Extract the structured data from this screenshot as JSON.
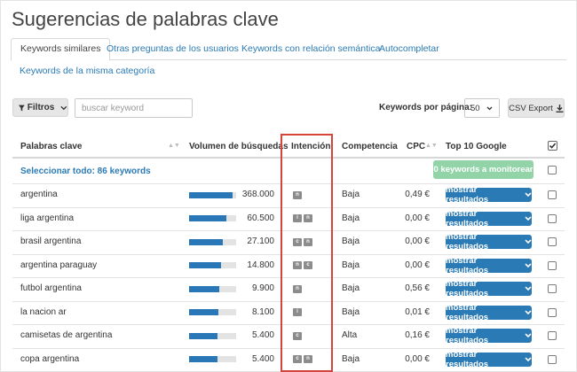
{
  "page": {
    "title": "Sugerencias de palabras clave"
  },
  "tabs": [
    {
      "label": "Keywords similares",
      "active": true
    },
    {
      "label": "Otras preguntas de los usuarios"
    },
    {
      "label": "Keywords con relación semántica"
    },
    {
      "label": "Autocompletar"
    },
    {
      "label": "Keywords de la misma categoría"
    }
  ],
  "toolbar": {
    "filter_label": "Filtros",
    "search_placeholder": "buscar keyword",
    "per_page_label": "Keywords por página:",
    "per_page_value": "50",
    "csv_label": "CSV Export"
  },
  "table": {
    "headers": {
      "keyword": "Palabras clave",
      "volume": "Volumen de búsquedas",
      "intent": "Intención",
      "competition": "Competencia",
      "cpc": "CPC",
      "top10": "Top 10 Google"
    },
    "select_all": "Seleccionar todo: 86 keywords",
    "monitor_button": "0 keywords a monitorear",
    "results_button": "mostrar resultados",
    "rows": [
      {
        "keyword": "argentina",
        "volume": "368.000",
        "volume_fraction": 0.92,
        "intent": [
          "n"
        ],
        "competition": "Baja",
        "cpc": "0,49 €"
      },
      {
        "keyword": "liga argentina",
        "volume": "60.500",
        "volume_fraction": 0.8,
        "intent": [
          "i",
          "n"
        ],
        "competition": "Baja",
        "cpc": "0,00 €"
      },
      {
        "keyword": "brasil argentina",
        "volume": "27.100",
        "volume_fraction": 0.72,
        "intent": [
          "c",
          "n"
        ],
        "competition": "Baja",
        "cpc": "0,00 €"
      },
      {
        "keyword": "argentina paraguay",
        "volume": "14.800",
        "volume_fraction": 0.68,
        "intent": [
          "n",
          "c"
        ],
        "competition": "Baja",
        "cpc": "0,00 €"
      },
      {
        "keyword": "futbol argentina",
        "volume": "9.900",
        "volume_fraction": 0.64,
        "intent": [
          "n"
        ],
        "competition": "Baja",
        "cpc": "0,56 €"
      },
      {
        "keyword": "la nacion ar",
        "volume": "8.100",
        "volume_fraction": 0.62,
        "intent": [
          "i"
        ],
        "competition": "Baja",
        "cpc": "0,01 €"
      },
      {
        "keyword": "camisetas de argentina",
        "volume": "5.400",
        "volume_fraction": 0.6,
        "intent": [
          "c"
        ],
        "competition": "Alta",
        "cpc": "0,16 €"
      },
      {
        "keyword": "copa argentina",
        "volume": "5.400",
        "volume_fraction": 0.6,
        "intent": [
          "c",
          "n"
        ],
        "competition": "Baja",
        "cpc": "0,00 €"
      }
    ]
  },
  "colors": {
    "accent": "#2a7ab5",
    "volume_bar": "#2a77b7",
    "monitor_button": "#92d4a8",
    "highlight": "#d5453c",
    "intent_badge": "#8c8c8c"
  },
  "icons": {
    "filter": "funnel-icon",
    "dropdown": "chevron-down-icon",
    "download": "download-icon",
    "select_all_header": "checkbox-checked-icon",
    "sort": "sort-icon"
  }
}
